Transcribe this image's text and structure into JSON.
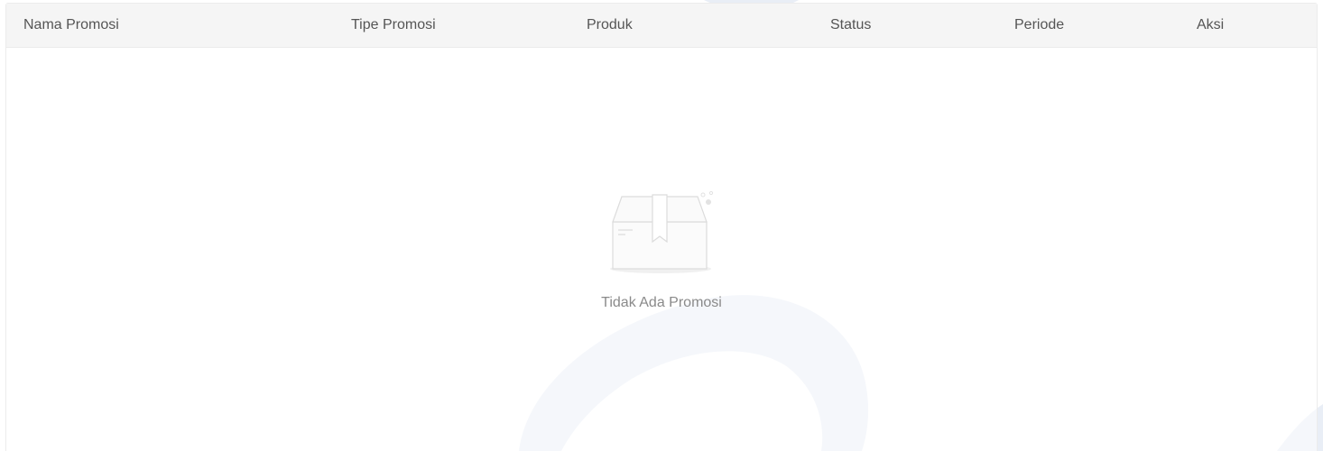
{
  "table": {
    "columns": [
      "Nama Promosi",
      "Tipe Promosi",
      "Produk",
      "Status",
      "Periode",
      "Aksi"
    ]
  },
  "empty_state": {
    "icon": "empty-box-icon",
    "message": "Tidak Ada Promosi"
  }
}
